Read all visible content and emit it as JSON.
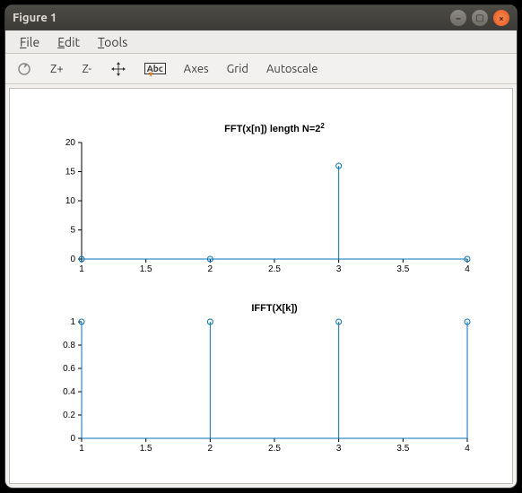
{
  "window": {
    "title": "Figure 1",
    "buttons": {
      "min": "–",
      "max": "▢",
      "close": "×"
    }
  },
  "menubar": {
    "file": "File",
    "edit": "Edit",
    "tools": "Tools"
  },
  "toolbar": {
    "rotate": "↻",
    "zoom_in": "Z+",
    "zoom_out": "Z-",
    "pan": "✥",
    "text": "Abc",
    "axes": "Axes",
    "grid": "Grid",
    "autoscale": "Autoscale"
  },
  "chart_data": [
    {
      "type": "stem",
      "title": "FFT(x[n])  length N=2",
      "title_sup": "2",
      "x": [
        1,
        2,
        3,
        4
      ],
      "y": [
        0,
        0,
        16,
        0
      ],
      "xlim": [
        1,
        4
      ],
      "ylim": [
        0,
        20
      ],
      "xticks": [
        1,
        1.5,
        2,
        2.5,
        3,
        3.5,
        4
      ],
      "yticks": [
        0,
        5,
        10,
        15,
        20
      ]
    },
    {
      "type": "stem",
      "title": "IFFT(X[k])",
      "x": [
        1,
        2,
        3,
        4
      ],
      "y": [
        1,
        1,
        1,
        1
      ],
      "xlim": [
        1,
        4
      ],
      "ylim": [
        0,
        1
      ],
      "xticks": [
        1,
        1.5,
        2,
        2.5,
        3,
        3.5,
        4
      ],
      "yticks": [
        0,
        0.2,
        0.4,
        0.6,
        0.8,
        1
      ]
    }
  ]
}
